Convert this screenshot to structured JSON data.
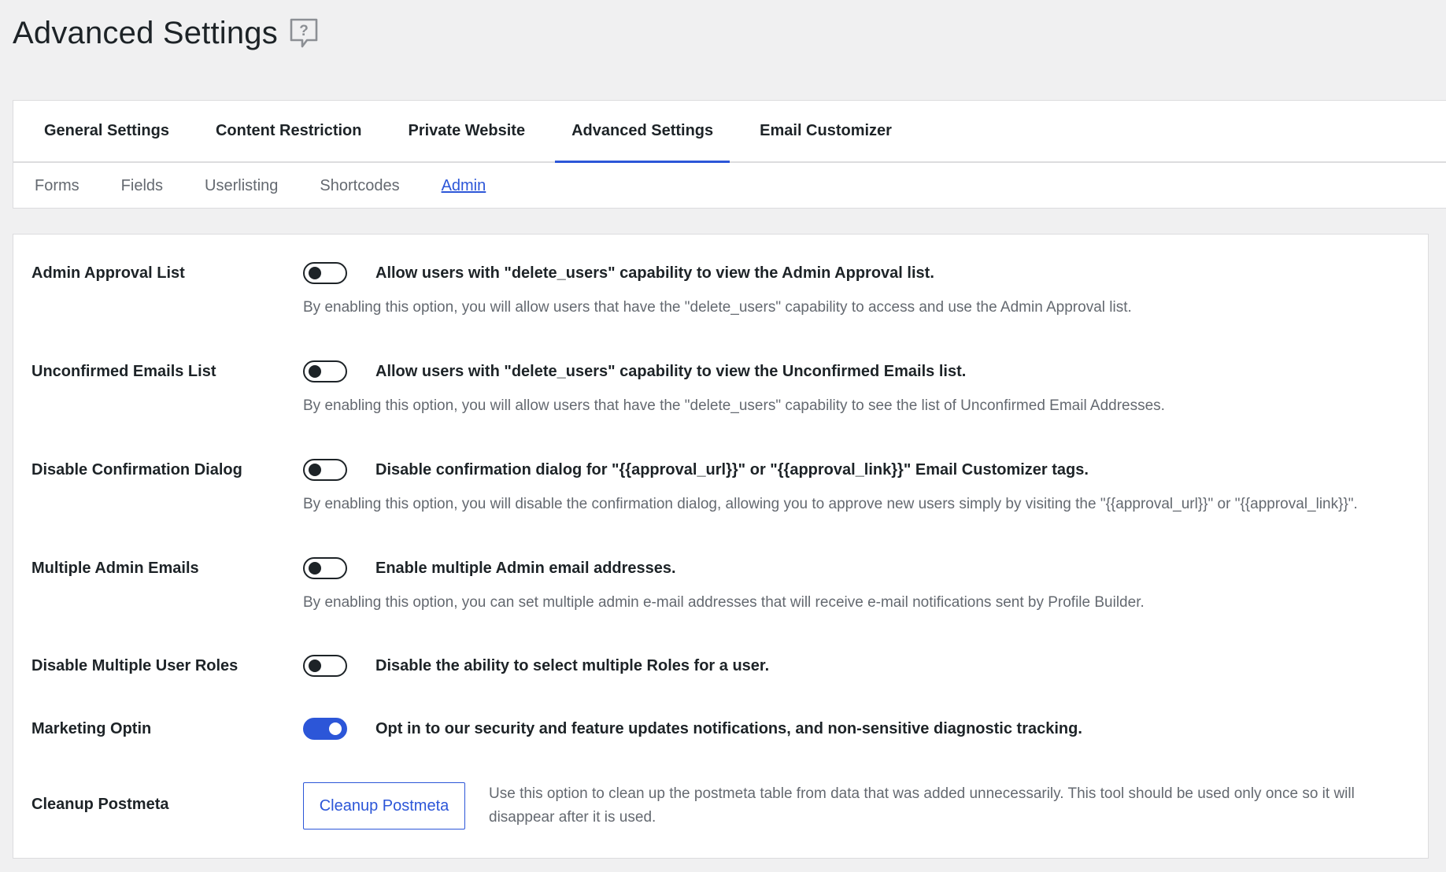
{
  "page": {
    "title": "Advanced Settings"
  },
  "main_tabs": [
    {
      "label": "General Settings",
      "active": false
    },
    {
      "label": "Content Restriction",
      "active": false
    },
    {
      "label": "Private Website",
      "active": false
    },
    {
      "label": "Advanced Settings",
      "active": true
    },
    {
      "label": "Email Customizer",
      "active": false
    }
  ],
  "sub_tabs": [
    {
      "label": "Forms",
      "active": false
    },
    {
      "label": "Fields",
      "active": false
    },
    {
      "label": "Userlisting",
      "active": false
    },
    {
      "label": "Shortcodes",
      "active": false
    },
    {
      "label": "Admin",
      "active": true
    }
  ],
  "settings": [
    {
      "label": "Admin Approval List",
      "enabled": false,
      "description": "Allow users with \"delete_users\" capability to view the Admin Approval list.",
      "help": "By enabling this option, you will allow users that have the \"delete_users\" capability to access and use the Admin Approval list."
    },
    {
      "label": "Unconfirmed Emails List",
      "enabled": false,
      "description": "Allow users with \"delete_users\" capability to view the Unconfirmed Emails list.",
      "help": "By enabling this option, you will allow users that have the \"delete_users\" capability to see the list of Unconfirmed Email Addresses."
    },
    {
      "label": "Disable Confirmation Dialog",
      "enabled": false,
      "description": "Disable confirmation dialog for \"{{approval_url}}\" or \"{{approval_link}}\" Email Customizer tags.",
      "help": "By enabling this option, you will disable the confirmation dialog, allowing you to approve new users simply by visiting the \"{{approval_url}}\" or \"{{approval_link}}\"."
    },
    {
      "label": "Multiple Admin Emails",
      "enabled": false,
      "description": "Enable multiple Admin email addresses.",
      "help": "By enabling this option, you can set multiple admin e-mail addresses that will receive e-mail notifications sent by Profile Builder."
    },
    {
      "label": "Disable Multiple User Roles",
      "enabled": false,
      "description": "Disable the ability to select multiple Roles for a user."
    },
    {
      "label": "Marketing Optin",
      "enabled": true,
      "description": "Opt in to our security and feature updates notifications, and non-sensitive diagnostic tracking."
    }
  ],
  "cleanup": {
    "label": "Cleanup Postmeta",
    "button_label": "Cleanup Postmeta",
    "help": "Use this option to clean up the postmeta table from data that was added unnecessarily. This tool should be used only once so it will disappear after it is used."
  },
  "colors": {
    "accent": "#2c56d8",
    "background": "#f0f0f1",
    "text": "#1d2327",
    "muted_text": "#646970"
  },
  "icons": {
    "help": "help-question-icon"
  }
}
